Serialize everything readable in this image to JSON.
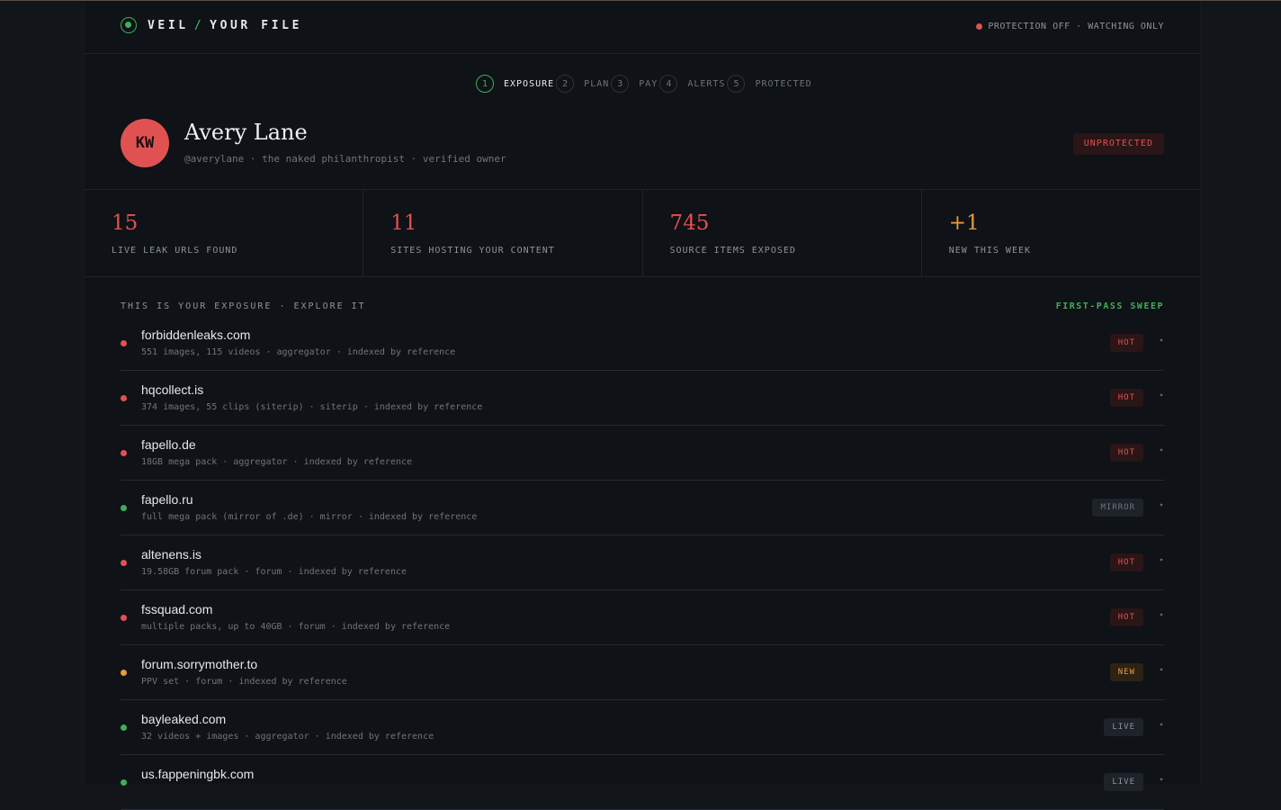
{
  "brand": {
    "name": "VEIL",
    "separator": "/",
    "section": "YOUR FILE",
    "icon": "veil-logo-icon"
  },
  "status": {
    "text": "PROTECTION OFF · WATCHING ONLY",
    "color": "#e05252"
  },
  "steps": [
    {
      "num": "1",
      "label": "EXPOSURE",
      "active": true
    },
    {
      "num": "2",
      "label": "PLAN",
      "active": false
    },
    {
      "num": "3",
      "label": "PAY",
      "active": false
    },
    {
      "num": "4",
      "label": "ALERTS",
      "active": false
    },
    {
      "num": "5",
      "label": "PROTECTED",
      "active": false
    }
  ],
  "profile": {
    "initials": "KW",
    "name": "Avery Lane",
    "handle": "@averylane · the naked philanthropist · verified owner",
    "badge": "UNPROTECTED"
  },
  "stats": [
    {
      "value": "15",
      "label": "LIVE LEAK URLS FOUND"
    },
    {
      "value": "11",
      "label": "SITES HOSTING YOUR CONTENT"
    },
    {
      "value": "745",
      "label": "SOURCE ITEMS EXPOSED"
    },
    {
      "value": "+1",
      "label": "NEW THIS WEEK"
    }
  ],
  "exposure": {
    "title": "THIS IS YOUR EXPOSURE · EXPLORE IT",
    "sweep": "FIRST-PASS SWEEP",
    "rows": [
      {
        "domain": "forbiddenleaks.com",
        "meta": "551 images, 115 videos · aggregator · indexed by reference",
        "tag": "HOT",
        "status": "hot",
        "arrow": "▸"
      },
      {
        "domain": "hqcollect.is",
        "meta": "374 images, 55 clips (siterip) · siterip · indexed by reference",
        "tag": "HOT",
        "status": "hot",
        "arrow": "▸"
      },
      {
        "domain": "fapello.de",
        "meta": "18GB mega pack · aggregator · indexed by reference",
        "tag": "HOT",
        "status": "hot",
        "arrow": "▸"
      },
      {
        "domain": "fapello.ru",
        "meta": "full mega pack (mirror of .de) · mirror · indexed by reference",
        "tag": "MIRROR",
        "status": "mirror",
        "arrow": "▸"
      },
      {
        "domain": "altenens.is",
        "meta": "19.58GB forum pack · forum · indexed by reference",
        "tag": "HOT",
        "status": "hot",
        "arrow": "▸"
      },
      {
        "domain": "fssquad.com",
        "meta": "multiple packs, up to 40GB · forum · indexed by reference",
        "tag": "HOT",
        "status": "hot",
        "arrow": "▸"
      },
      {
        "domain": "forum.sorrymother.to",
        "meta": "PPV set · forum · indexed by reference",
        "tag": "NEW",
        "status": "new",
        "arrow": "▸"
      },
      {
        "domain": "bayleaked.com",
        "meta": "32 videos + images · aggregator · indexed by reference",
        "tag": "LIVE",
        "status": "live",
        "arrow": "▸"
      },
      {
        "domain": "us.fappeningbk.com",
        "meta": "",
        "tag": "LIVE",
        "status": "live",
        "arrow": "▸"
      }
    ]
  },
  "colors": {
    "hot": "#e05252",
    "mirror": "#3fae5b",
    "new": "#e89a40",
    "live": "#3fae5b",
    "accent": "#3fae5b"
  }
}
